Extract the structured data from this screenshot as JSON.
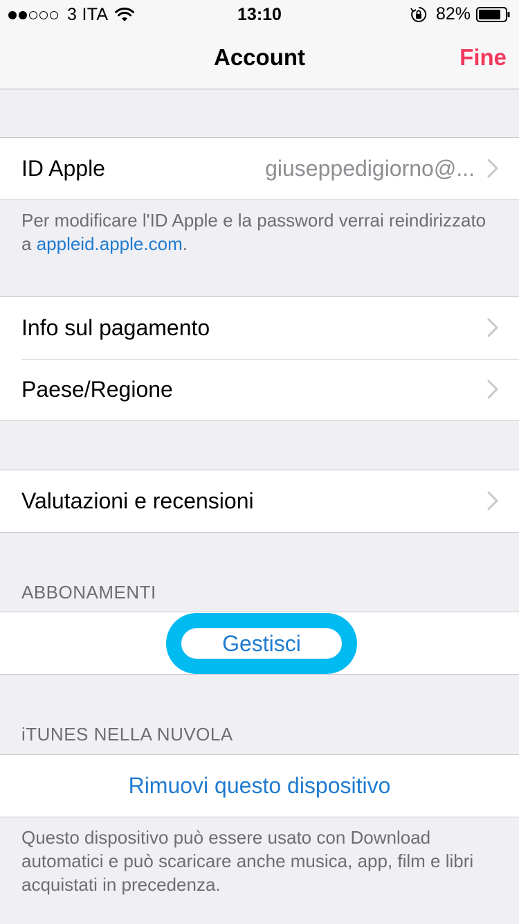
{
  "status_bar": {
    "signal_dots_filled": 2,
    "signal_dots_total": 5,
    "carrier": "3 ITA",
    "time": "13:10",
    "battery_percent": "82%"
  },
  "nav": {
    "title": "Account",
    "done_label": "Fine"
  },
  "apple_id": {
    "label": "ID Apple",
    "value": "giuseppedigiorno@..."
  },
  "apple_id_note": {
    "text": "Per modificare l'ID Apple e la password verrai reindirizzato a ",
    "link": "appleid.apple.com",
    "suffix": "."
  },
  "payment_group": {
    "items": [
      {
        "label": "Info sul pagamento"
      },
      {
        "label": "Paese/Regione"
      }
    ]
  },
  "ratings": {
    "label": "Valutazioni e recensioni"
  },
  "subscriptions": {
    "header": "ABBONAMENTI",
    "manage_label": "Gestisci"
  },
  "itunes_cloud": {
    "header": "iTUNES NELLA NUVOLA",
    "remove_label": "Rimuovi questo dispositivo",
    "note": "Questo dispositivo può essere usato con Download automatici e può scaricare anche musica, app, film e libri acquistati in precedenza."
  },
  "colors": {
    "accent_blue": "#1f7bd0",
    "done_red": "#f2385d",
    "highlight_cyan": "#00baf2",
    "background": "#efeff4"
  }
}
